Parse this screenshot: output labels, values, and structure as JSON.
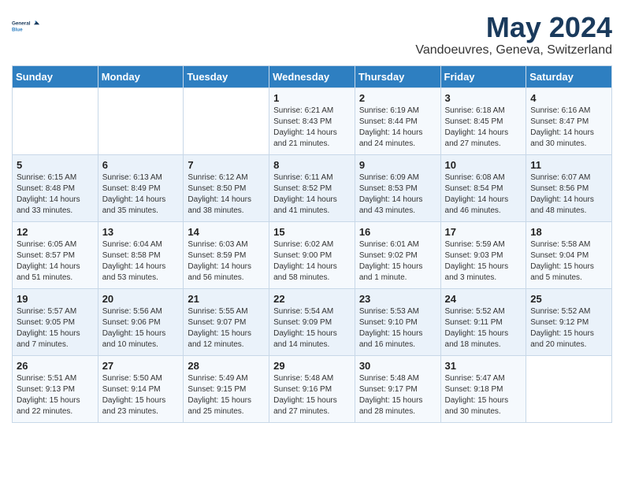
{
  "header": {
    "logo_line1": "General",
    "logo_line2": "Blue",
    "title": "May 2024",
    "subtitle": "Vandoeuvres, Geneva, Switzerland"
  },
  "days_of_week": [
    "Sunday",
    "Monday",
    "Tuesday",
    "Wednesday",
    "Thursday",
    "Friday",
    "Saturday"
  ],
  "weeks": [
    [
      {
        "day": "",
        "content": ""
      },
      {
        "day": "",
        "content": ""
      },
      {
        "day": "",
        "content": ""
      },
      {
        "day": "1",
        "content": "Sunrise: 6:21 AM\nSunset: 8:43 PM\nDaylight: 14 hours\nand 21 minutes."
      },
      {
        "day": "2",
        "content": "Sunrise: 6:19 AM\nSunset: 8:44 PM\nDaylight: 14 hours\nand 24 minutes."
      },
      {
        "day": "3",
        "content": "Sunrise: 6:18 AM\nSunset: 8:45 PM\nDaylight: 14 hours\nand 27 minutes."
      },
      {
        "day": "4",
        "content": "Sunrise: 6:16 AM\nSunset: 8:47 PM\nDaylight: 14 hours\nand 30 minutes."
      }
    ],
    [
      {
        "day": "5",
        "content": "Sunrise: 6:15 AM\nSunset: 8:48 PM\nDaylight: 14 hours\nand 33 minutes."
      },
      {
        "day": "6",
        "content": "Sunrise: 6:13 AM\nSunset: 8:49 PM\nDaylight: 14 hours\nand 35 minutes."
      },
      {
        "day": "7",
        "content": "Sunrise: 6:12 AM\nSunset: 8:50 PM\nDaylight: 14 hours\nand 38 minutes."
      },
      {
        "day": "8",
        "content": "Sunrise: 6:11 AM\nSunset: 8:52 PM\nDaylight: 14 hours\nand 41 minutes."
      },
      {
        "day": "9",
        "content": "Sunrise: 6:09 AM\nSunset: 8:53 PM\nDaylight: 14 hours\nand 43 minutes."
      },
      {
        "day": "10",
        "content": "Sunrise: 6:08 AM\nSunset: 8:54 PM\nDaylight: 14 hours\nand 46 minutes."
      },
      {
        "day": "11",
        "content": "Sunrise: 6:07 AM\nSunset: 8:56 PM\nDaylight: 14 hours\nand 48 minutes."
      }
    ],
    [
      {
        "day": "12",
        "content": "Sunrise: 6:05 AM\nSunset: 8:57 PM\nDaylight: 14 hours\nand 51 minutes."
      },
      {
        "day": "13",
        "content": "Sunrise: 6:04 AM\nSunset: 8:58 PM\nDaylight: 14 hours\nand 53 minutes."
      },
      {
        "day": "14",
        "content": "Sunrise: 6:03 AM\nSunset: 8:59 PM\nDaylight: 14 hours\nand 56 minutes."
      },
      {
        "day": "15",
        "content": "Sunrise: 6:02 AM\nSunset: 9:00 PM\nDaylight: 14 hours\nand 58 minutes."
      },
      {
        "day": "16",
        "content": "Sunrise: 6:01 AM\nSunset: 9:02 PM\nDaylight: 15 hours\nand 1 minute."
      },
      {
        "day": "17",
        "content": "Sunrise: 5:59 AM\nSunset: 9:03 PM\nDaylight: 15 hours\nand 3 minutes."
      },
      {
        "day": "18",
        "content": "Sunrise: 5:58 AM\nSunset: 9:04 PM\nDaylight: 15 hours\nand 5 minutes."
      }
    ],
    [
      {
        "day": "19",
        "content": "Sunrise: 5:57 AM\nSunset: 9:05 PM\nDaylight: 15 hours\nand 7 minutes."
      },
      {
        "day": "20",
        "content": "Sunrise: 5:56 AM\nSunset: 9:06 PM\nDaylight: 15 hours\nand 10 minutes."
      },
      {
        "day": "21",
        "content": "Sunrise: 5:55 AM\nSunset: 9:07 PM\nDaylight: 15 hours\nand 12 minutes."
      },
      {
        "day": "22",
        "content": "Sunrise: 5:54 AM\nSunset: 9:09 PM\nDaylight: 15 hours\nand 14 minutes."
      },
      {
        "day": "23",
        "content": "Sunrise: 5:53 AM\nSunset: 9:10 PM\nDaylight: 15 hours\nand 16 minutes."
      },
      {
        "day": "24",
        "content": "Sunrise: 5:52 AM\nSunset: 9:11 PM\nDaylight: 15 hours\nand 18 minutes."
      },
      {
        "day": "25",
        "content": "Sunrise: 5:52 AM\nSunset: 9:12 PM\nDaylight: 15 hours\nand 20 minutes."
      }
    ],
    [
      {
        "day": "26",
        "content": "Sunrise: 5:51 AM\nSunset: 9:13 PM\nDaylight: 15 hours\nand 22 minutes."
      },
      {
        "day": "27",
        "content": "Sunrise: 5:50 AM\nSunset: 9:14 PM\nDaylight: 15 hours\nand 23 minutes."
      },
      {
        "day": "28",
        "content": "Sunrise: 5:49 AM\nSunset: 9:15 PM\nDaylight: 15 hours\nand 25 minutes."
      },
      {
        "day": "29",
        "content": "Sunrise: 5:48 AM\nSunset: 9:16 PM\nDaylight: 15 hours\nand 27 minutes."
      },
      {
        "day": "30",
        "content": "Sunrise: 5:48 AM\nSunset: 9:17 PM\nDaylight: 15 hours\nand 28 minutes."
      },
      {
        "day": "31",
        "content": "Sunrise: 5:47 AM\nSunset: 9:18 PM\nDaylight: 15 hours\nand 30 minutes."
      },
      {
        "day": "",
        "content": ""
      }
    ]
  ]
}
